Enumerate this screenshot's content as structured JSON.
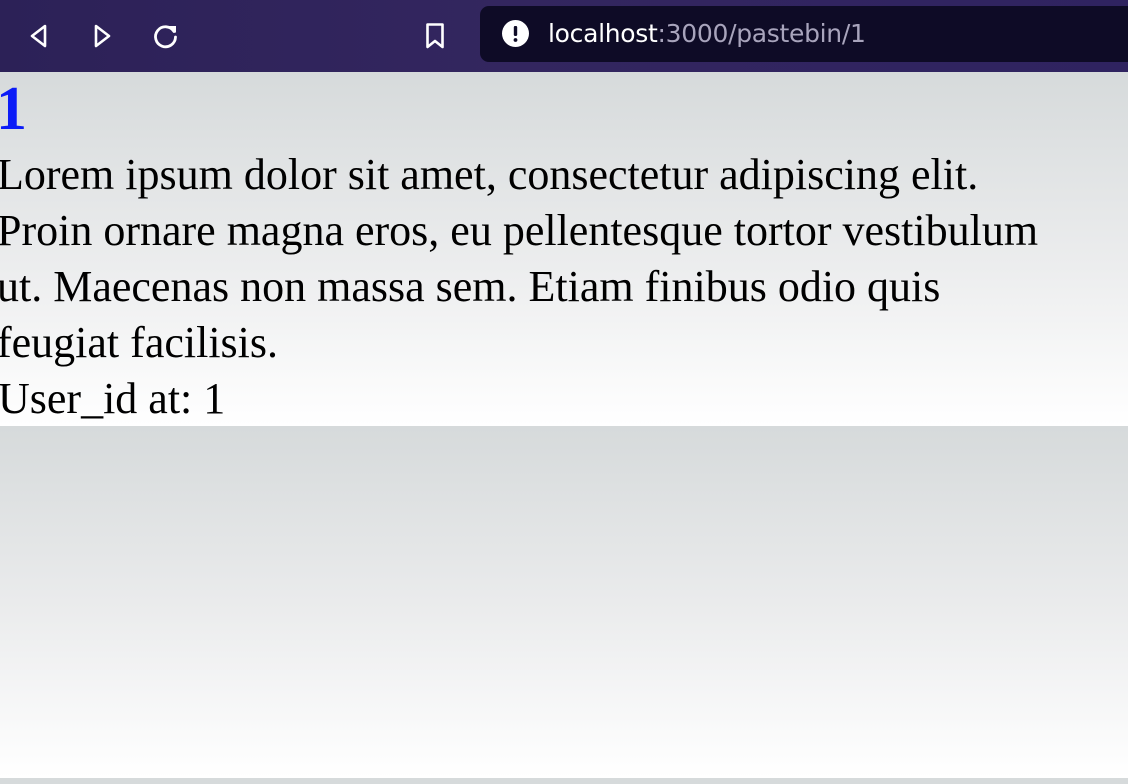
{
  "browser": {
    "url_host": "localhost",
    "url_rest": ":3000/pastebin/1",
    "toolbar_icons": [
      "back-icon",
      "forward-icon",
      "reload-icon",
      "bookmark-icon",
      "info-icon"
    ]
  },
  "page": {
    "title": "1",
    "body_lines": [
      "Lorem ipsum dolor sit amet, consectetur adipiscing elit.",
      "Proin ornare magna eros, eu pellentesque tortor vestibulum",
      "ut. Maecenas non massa sem. Etiam finibus odio quis",
      "feugiat facilisis."
    ],
    "user_line": "User_id at: 1"
  },
  "colors": {
    "toolbar": "#2f2360",
    "urlbar": "#0e0b26",
    "link": "#0c1cf7"
  }
}
